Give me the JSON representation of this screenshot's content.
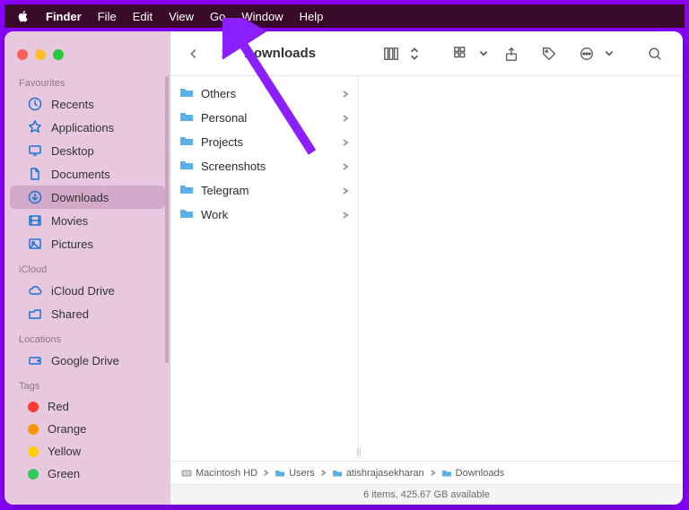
{
  "menubar": {
    "app": "Finder",
    "items": [
      "File",
      "Edit",
      "View",
      "Go",
      "Window",
      "Help"
    ]
  },
  "sidebar": {
    "sections": [
      {
        "label": "Favourites",
        "items": [
          {
            "icon": "clock-icon",
            "label": "Recents"
          },
          {
            "icon": "apps-icon",
            "label": "Applications"
          },
          {
            "icon": "desktop-icon",
            "label": "Desktop"
          },
          {
            "icon": "document-icon",
            "label": "Documents"
          },
          {
            "icon": "download-icon",
            "label": "Downloads",
            "selected": true
          },
          {
            "icon": "movie-icon",
            "label": "Movies"
          },
          {
            "icon": "picture-icon",
            "label": "Pictures"
          }
        ]
      },
      {
        "label": "iCloud",
        "items": [
          {
            "icon": "cloud-icon",
            "label": "iCloud Drive"
          },
          {
            "icon": "shared-icon",
            "label": "Shared"
          }
        ]
      },
      {
        "label": "Locations",
        "items": [
          {
            "icon": "drive-icon",
            "label": "Google Drive"
          }
        ]
      },
      {
        "label": "Tags",
        "items": [
          {
            "icon": "tag",
            "color": "#ff3b30",
            "label": "Red"
          },
          {
            "icon": "tag",
            "color": "#ff9500",
            "label": "Orange"
          },
          {
            "icon": "tag",
            "color": "#ffcc00",
            "label": "Yellow"
          },
          {
            "icon": "tag",
            "color": "#34c759",
            "label": "Green"
          }
        ]
      }
    ]
  },
  "toolbar": {
    "title": "Downloads"
  },
  "folders": [
    {
      "name": "Others"
    },
    {
      "name": "Personal"
    },
    {
      "name": "Projects"
    },
    {
      "name": "Screenshots"
    },
    {
      "name": "Telegram"
    },
    {
      "name": "Work"
    }
  ],
  "pathbar": [
    {
      "icon": "disk",
      "label": "Macintosh HD"
    },
    {
      "icon": "folder",
      "label": "Users"
    },
    {
      "icon": "folder",
      "label": "atishrajasekharan"
    },
    {
      "icon": "folder",
      "label": "Downloads"
    }
  ],
  "statusbar": "6 items, 425.67 GB available",
  "annotation": {
    "target": "Go menu",
    "color": "#8c1fff"
  }
}
